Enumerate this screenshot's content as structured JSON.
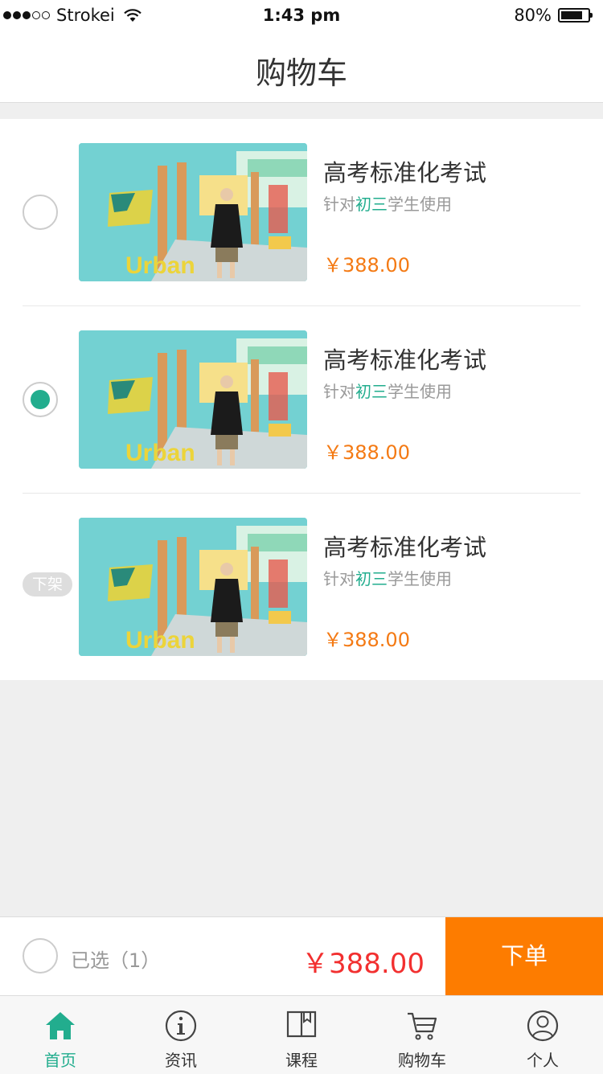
{
  "status_bar": {
    "carrier": "Strokei",
    "time": "1:43 pm",
    "battery": "80%",
    "battery_level": 0.8
  },
  "nav": {
    "title": "购物车"
  },
  "items": [
    {
      "title": "高考标准化考试",
      "desc_prefix": "针对",
      "desc_highlight": "初三",
      "desc_suffix": "学生使用",
      "price": "￥388.00",
      "state": "unchecked"
    },
    {
      "title": "高考标准化考试",
      "desc_prefix": "针对",
      "desc_highlight": "初三",
      "desc_suffix": "学生使用",
      "price": "￥388.00",
      "state": "checked"
    },
    {
      "title": "高考标准化考试",
      "desc_prefix": "针对",
      "desc_highlight": "初三",
      "desc_suffix": "学生使用",
      "price": "￥388.00",
      "state": "off-shelf",
      "badge": "下架"
    }
  ],
  "checkout": {
    "selected_label": "已选（1）",
    "total": "￥388.00",
    "order_button": "下单"
  },
  "tabs": [
    {
      "label": "首页",
      "icon": "home-icon",
      "active": true
    },
    {
      "label": "资讯",
      "icon": "info-icon",
      "active": false
    },
    {
      "label": "课程",
      "icon": "book-icon",
      "active": false
    },
    {
      "label": "购物车",
      "icon": "cart-icon",
      "active": false
    },
    {
      "label": "个人",
      "icon": "user-icon",
      "active": false
    }
  ],
  "colors": {
    "accent": "#22ad8e",
    "price": "#f47a14",
    "total": "#f23030",
    "order_button": "#fd7c00"
  }
}
